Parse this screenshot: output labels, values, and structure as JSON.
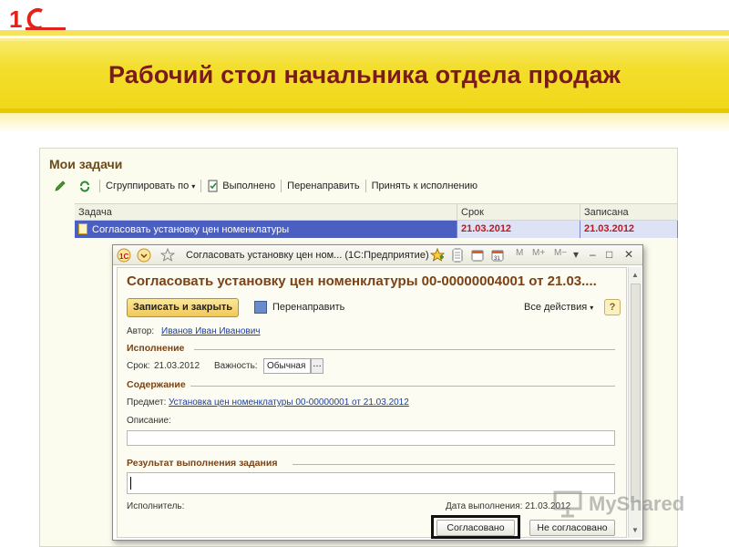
{
  "slide": {
    "logo_text": "1С",
    "title": "Рабочий стол начальника отдела продаж"
  },
  "tasks": {
    "title": "Мои задачи",
    "toolbar": {
      "group_by": "Сгруппировать по",
      "done": "Выполнено",
      "redirect": "Перенаправить",
      "accept": "Принять к исполнению"
    },
    "columns": [
      "Задача",
      "Срок",
      "Записана"
    ],
    "rows": [
      {
        "task": "Согласовать установку цен номенклатуры",
        "due": "21.03.2012",
        "recorded": "21.03.2012"
      }
    ]
  },
  "dialog": {
    "window_title": "Согласовать установку цен ном... (1С:Предприятие)",
    "title_icons": [
      "1c-logo-icon",
      "menu-dropdown-icon",
      "star-icon",
      "add-favorite-icon",
      "document-icon",
      "calendar-icon",
      "calendar-31-icon"
    ],
    "title_text_buttons": [
      "M",
      "M+",
      "M−"
    ],
    "doc_title": "Согласовать установку цен номенклатуры 00-00000004001 от 21.03....",
    "save_close": "Записать и закрыть",
    "redirect": "Перенаправить",
    "all_actions": "Все действия",
    "help": "?",
    "author_label": "Автор:",
    "author": "Иванов Иван Иванович",
    "section_execution": "Исполнение",
    "due_label": "Срок:",
    "due": "21.03.2012",
    "importance_label": "Важность:",
    "importance": "Обычная",
    "section_content": "Содержание",
    "subject_label": "Предмет:",
    "subject": "Установка цен номенклатуры 00-00000001 от 21.03.2012",
    "description_label": "Описание:",
    "section_result": "Результат выполнения задания",
    "executor_label": "Исполнитель:",
    "done_date_label": "Дата выполнения: 21.03.2012",
    "approved": "Согласовано",
    "not_approved": "Не согласовано"
  },
  "watermark": "MyShared",
  "colors": {
    "title_band": "#f1d81a",
    "title_text": "#7a1a1a",
    "selected_row": "#4a5fbf",
    "date_red": "#c0161c",
    "section_brown": "#7a4216"
  }
}
